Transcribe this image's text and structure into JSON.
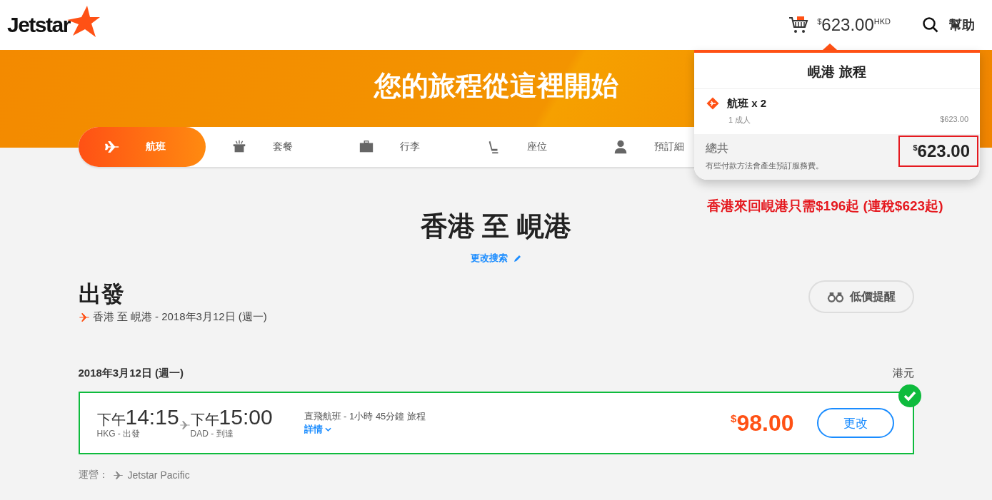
{
  "header": {
    "logo": "Jetstar",
    "cart_currency_symbol": "$",
    "cart_total": "623.00",
    "cart_currency": "HKD",
    "help": "幫助"
  },
  "banner": {
    "title": "您的旅程從這裡開始"
  },
  "tabs": [
    {
      "label": "航班",
      "kind": "flight",
      "selected": true
    },
    {
      "label": "套餐",
      "kind": "bundle",
      "selected": false
    },
    {
      "label": "行李",
      "kind": "baggage",
      "selected": false
    },
    {
      "label": "座位",
      "kind": "seat",
      "selected": false
    },
    {
      "label": "預訂細",
      "kind": "booking",
      "selected": false
    }
  ],
  "cart_popup": {
    "title": "峴港 旅程",
    "item": "航班 x 2",
    "passengers": "1 成人",
    "item_price": "$623.00",
    "total_label": "總共",
    "total_symbol": "$",
    "total": "623.00",
    "note": "有些付款方法會產生預訂服務費。"
  },
  "annotation": "香港來回峴港只需$196起 (連稅$623起)",
  "route_title": "香港 至 峴港",
  "change_search": "更改搜索",
  "departure": {
    "heading": "出發",
    "route": "香港 至 峴港 - 2018年3月12日 (週一)",
    "alert_button": "低價提醒"
  },
  "date": "2018年3月12日 (週一)",
  "currency": "港元",
  "flights": [
    {
      "selected": true,
      "dep_period": "下午",
      "dep_time": "14:15",
      "dep_label": "HKG - 出發",
      "arr_period": "下午",
      "arr_time": "15:00",
      "arr_label": "DAD - 到達",
      "info": "直飛航班 - 1小時 45分鐘 旅程",
      "details": "詳情",
      "price_symbol": "$",
      "price": "98.00",
      "change_button": "更改"
    }
  ],
  "operator_label": "運營：",
  "operator": "Jetstar Pacific"
}
